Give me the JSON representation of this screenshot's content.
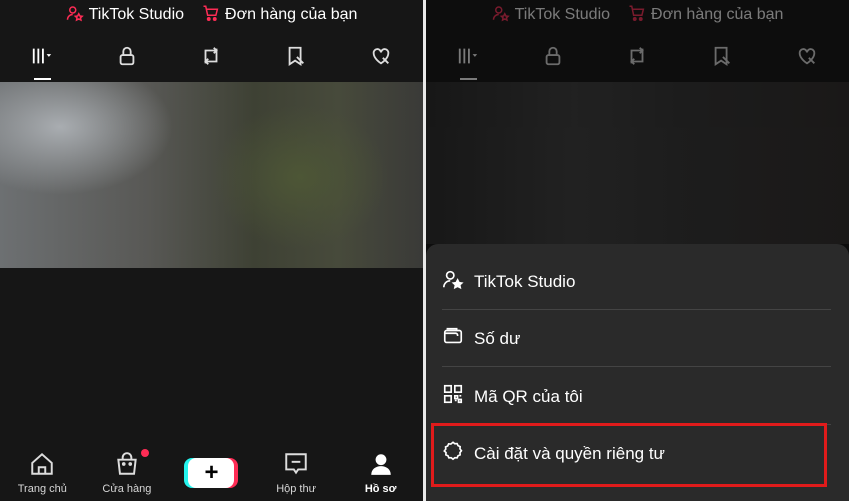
{
  "top_links": {
    "studio_label": "TikTok Studio",
    "orders_label": "Đơn hàng của bạn",
    "studio_icon": "person-star-icon",
    "orders_icon": "cart-icon",
    "accent_color": "#fe2c55"
  },
  "tabs": [
    {
      "icon": "grid-icon",
      "active": true
    },
    {
      "icon": "lock-icon"
    },
    {
      "icon": "repost-icon"
    },
    {
      "icon": "bookmark-icon"
    },
    {
      "icon": "heart-icon"
    }
  ],
  "bottom_nav": {
    "home": "Trang chủ",
    "shop": "Cửa hàng",
    "inbox": "Hộp thư",
    "profile": "Hồ sơ",
    "create": "+"
  },
  "menu": {
    "items": [
      {
        "label": "TikTok Studio",
        "icon": "person-star-icon"
      },
      {
        "label": "Số dư",
        "icon": "wallet-icon"
      },
      {
        "label": "Mã QR của tôi",
        "icon": "qr-code-icon"
      },
      {
        "label": "Cài đặt và quyền riêng tư",
        "icon": "settings-icon",
        "highlighted": true
      }
    ],
    "highlight_color": "#e01b1b"
  }
}
